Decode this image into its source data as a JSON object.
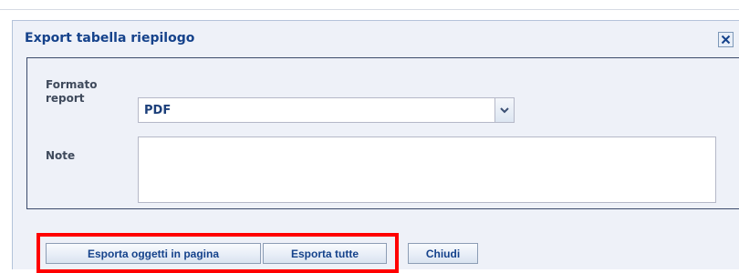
{
  "dialog": {
    "title": "Export tabella riepilogo",
    "close_icon": "close-icon"
  },
  "form": {
    "format_label": "Formato report",
    "format_value": "PDF",
    "format_dropdown_icon": "chevron-down-icon",
    "note_label": "Note",
    "note_value": ""
  },
  "buttons": {
    "export_page": "Esporta oggetti in pagina",
    "export_all": "Esporta tutte",
    "close": "Chiudi"
  },
  "colors": {
    "title_text": "#15428b",
    "dialog_background": "#eef1f8",
    "highlight": "#ff0000"
  }
}
